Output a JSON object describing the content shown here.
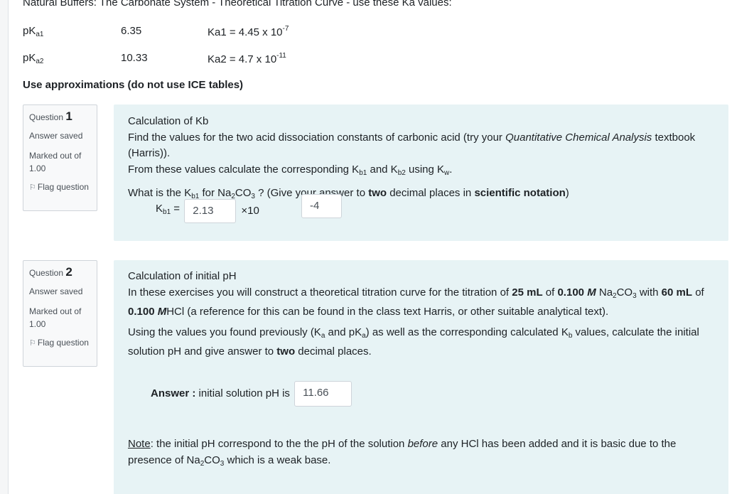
{
  "intro": {
    "title": "Natural Buffers: The Carbonate System - Theoretical Titration Curve - use these Ka values:",
    "rows": [
      {
        "pk_label_main": "pK",
        "pk_label_sub": "a1",
        "pk_value": "6.35",
        "ka_label": "Ka1 = 4.45 x 10",
        "ka_exp": "-7"
      },
      {
        "pk_label_main": "pK",
        "pk_label_sub": "a2",
        "pk_value": "10.33",
        "ka_label": "Ka2 = 4.7 x 10",
        "ka_exp": "-11"
      }
    ],
    "approx_note": "Use approximations (do not use ICE tables)"
  },
  "questions": [
    {
      "label": "Question ",
      "number": "1",
      "state": "Answer saved",
      "grade": "Marked out of 1.00",
      "flag": "Flag question",
      "heading": "Calculation of Kb",
      "text1_a": "Find the values for the two acid dissociation constants of carbonic acid (try your ",
      "text1_italic": "Quantitative Chemical Analysis",
      "text1_b": " textbook (Harris)).",
      "text2_a": "From these values calculate the corresponding K",
      "text2_sub1": "b1",
      "text2_b": " and K",
      "text2_sub2": "b2",
      "text2_c": " using K",
      "text2_sub3": "w",
      "text2_d": ".",
      "text3_a": "What is the K",
      "text3_sub": "b1",
      "text3_b": " for Na",
      "text3_sub2": "2",
      "text3_c": "CO",
      "text3_sub3": "3",
      "text3_d": " ? (Give your answer to ",
      "text3_bold1": "two",
      "text3_e": " decimal places in ",
      "text3_bold2": "scientific notation",
      "text3_f": ")",
      "kb_label_main": "K",
      "kb_label_sub": "b1",
      "kb_label_eq": " =",
      "mantissa_value": "2.13",
      "times_label": "×10",
      "exponent_value": "-4"
    },
    {
      "label": "Question ",
      "number": "2",
      "state": "Answer saved",
      "grade": "Marked out of 1.00",
      "flag": "Flag question",
      "heading": "Calculation of initial pH",
      "p1_a": "In these exercises you will construct a theoretical titration curve for the titration of ",
      "p1_b1": "25 mL",
      "p1_b": " of ",
      "p1_b2": "0.100 ",
      "p1_b2_italic": "M",
      "p1_c": " Na",
      "p1_sub1": "2",
      "p1_d": "CO",
      "p1_sub2": "3",
      "p1_e": " with ",
      "p1_b3": "60 mL",
      "p1_f": " of ",
      "p1_b4": "0.100 ",
      "p1_b4_italic": "M",
      "p1_g": "HCl (a reference for this can be found in the class text Harris, or other suitable analytical text).",
      "p2_a": "Using the values you found previously (K",
      "p2_sub1": "a",
      "p2_b": " and pK",
      "p2_sub2": "a",
      "p2_c": ") as well as the corresponding calculated K",
      "p2_sub3": "b",
      "p2_d": " values, calculate the initial solution pH and give answer to ",
      "p2_bold": "two",
      "p2_e": " decimal places.",
      "answer_label": "Answer :",
      "answer_text": " initial solution pH is",
      "answer_value": "11.66",
      "note_label": "Note",
      "note_a": ": the initial pH correspond to the the pH of the solution ",
      "note_italic": "before",
      "note_b": " any HCl has been added and it is basic due to the presence of Na",
      "note_sub1": "2",
      "note_c": "CO",
      "note_sub2": "3",
      "note_d": " which is a weak base."
    }
  ]
}
